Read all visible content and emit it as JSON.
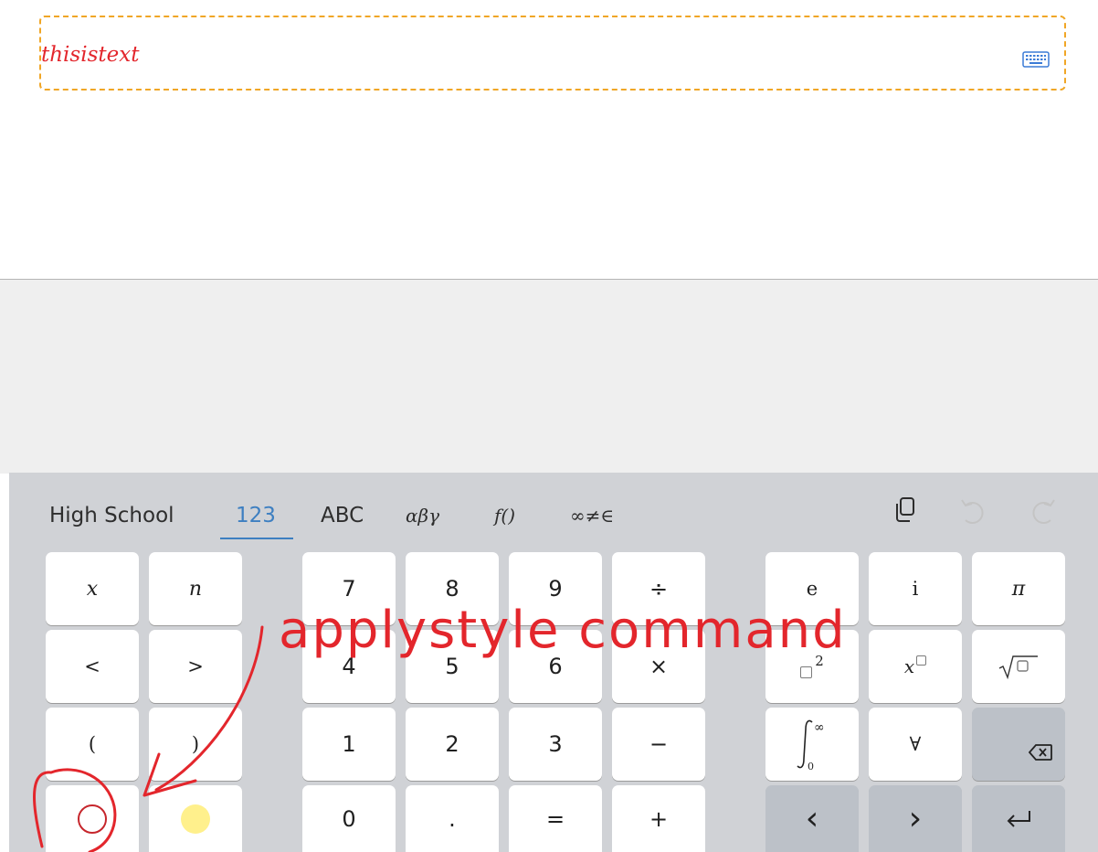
{
  "math_field": {
    "content": "thisistext",
    "toggle_icon": "keyboard-icon"
  },
  "keyboard": {
    "tabs": [
      {
        "label": "High School",
        "active": false
      },
      {
        "label": "123",
        "active": true
      },
      {
        "label": "ABC",
        "active": false
      },
      {
        "label": "αβγ",
        "active": false
      },
      {
        "label": "f()",
        "active": false
      },
      {
        "label": "∞≠∈",
        "active": false
      }
    ],
    "tools": [
      "copy-icon",
      "undo-icon",
      "redo-icon"
    ],
    "keys": {
      "var_x": "x",
      "var_n": "n",
      "less": "<",
      "greater": ">",
      "lparen": "(",
      "rparen": ")",
      "d7": "7",
      "d8": "8",
      "d9": "9",
      "div": "÷",
      "d4": "4",
      "d5": "5",
      "d6": "6",
      "mul": "×",
      "d1": "1",
      "d2": "2",
      "d3": "3",
      "minus": "−",
      "d0": "0",
      "dot": ".",
      "eq": "=",
      "plus": "+",
      "e": "e",
      "i": "i",
      "pi": "π",
      "sq_exp": "2",
      "pow_base": "x",
      "forall": "∀",
      "int_upper": "∞",
      "int_lower": "0",
      "left_arrow": "‹",
      "right_arrow": "›"
    },
    "swatch_colors": {
      "yellow": "#fff08c",
      "red": "#c6262c"
    }
  },
  "annotation": {
    "text": "applystyle command",
    "color": "#e3262c"
  }
}
